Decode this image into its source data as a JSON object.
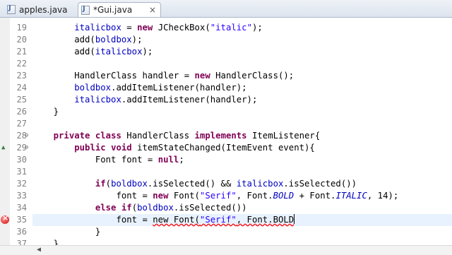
{
  "tabs": [
    {
      "label": "apples.java",
      "close": "×"
    },
    {
      "label": "*Gui.java",
      "close": "×"
    }
  ],
  "line_numbers": [
    "19",
    "20",
    "21",
    "22",
    "23",
    "24",
    "25",
    "26",
    "27",
    "28",
    "29",
    "30",
    "31",
    "32",
    "33",
    "34",
    "35",
    "36",
    "37"
  ],
  "lines": [
    [
      [
        "        ",
        ""
      ],
      [
        "italicbox",
        "fld"
      ],
      [
        " = ",
        ""
      ],
      [
        "new",
        "kw"
      ],
      [
        " JCheckBox(",
        ""
      ],
      [
        "\"italic\"",
        "str"
      ],
      [
        ");",
        ""
      ]
    ],
    [
      [
        "        add(",
        ""
      ],
      [
        "boldbox",
        "fld"
      ],
      [
        ");",
        ""
      ]
    ],
    [
      [
        "        add(",
        ""
      ],
      [
        "italicbox",
        "fld"
      ],
      [
        ");",
        ""
      ]
    ],
    [
      [
        "",
        ""
      ]
    ],
    [
      [
        "        HandlerClass handler = ",
        ""
      ],
      [
        "new",
        "kw"
      ],
      [
        " HandlerClass();",
        ""
      ]
    ],
    [
      [
        "        ",
        ""
      ],
      [
        "boldbox",
        "fld"
      ],
      [
        ".addItemListener(handler);",
        ""
      ]
    ],
    [
      [
        "        ",
        ""
      ],
      [
        "italicbox",
        "fld"
      ],
      [
        ".addItemListener(handler);",
        ""
      ]
    ],
    [
      [
        "    }",
        ""
      ]
    ],
    [
      [
        "",
        ""
      ]
    ],
    [
      [
        "    ",
        ""
      ],
      [
        "private",
        "kw"
      ],
      [
        " ",
        ""
      ],
      [
        "class",
        "kw"
      ],
      [
        " HandlerClass ",
        ""
      ],
      [
        "implements",
        "kw"
      ],
      [
        " ItemListener{",
        ""
      ]
    ],
    [
      [
        "        ",
        ""
      ],
      [
        "public",
        "kw"
      ],
      [
        " ",
        ""
      ],
      [
        "void",
        "kw"
      ],
      [
        " itemStateChanged(ItemEvent event){",
        ""
      ]
    ],
    [
      [
        "            Font font = ",
        ""
      ],
      [
        "null",
        "kw"
      ],
      [
        ";",
        ""
      ]
    ],
    [
      [
        "",
        ""
      ]
    ],
    [
      [
        "            ",
        ""
      ],
      [
        "if",
        "kw"
      ],
      [
        "(",
        ""
      ],
      [
        "boldbox",
        "fld"
      ],
      [
        ".isSelected() && ",
        ""
      ],
      [
        "italicbox",
        "fld"
      ],
      [
        ".isSelected())",
        ""
      ]
    ],
    [
      [
        "                font = ",
        ""
      ],
      [
        "new",
        "kw"
      ],
      [
        " Font(",
        ""
      ],
      [
        "\"Serif\"",
        "str"
      ],
      [
        ", Font.",
        ""
      ],
      [
        "BOLD",
        "stc"
      ],
      [
        " + Font.",
        ""
      ],
      [
        "ITALIC",
        "stc"
      ],
      [
        ", 14);",
        ""
      ]
    ],
    [
      [
        "            ",
        ""
      ],
      [
        "else",
        "kw"
      ],
      [
        " ",
        ""
      ],
      [
        "if",
        "kw"
      ],
      [
        "(",
        ""
      ],
      [
        "boldbox",
        "fld"
      ],
      [
        ".isSelected())",
        ""
      ]
    ],
    [
      [
        "                font = ",
        ""
      ],
      [
        "new Font(",
        "err"
      ],
      [
        "\"Serif\"",
        "str err"
      ],
      [
        ", Font.BOLD",
        "err"
      ]
    ],
    [
      [
        "            }",
        ""
      ]
    ],
    [
      [
        "    }",
        ""
      ]
    ]
  ]
}
